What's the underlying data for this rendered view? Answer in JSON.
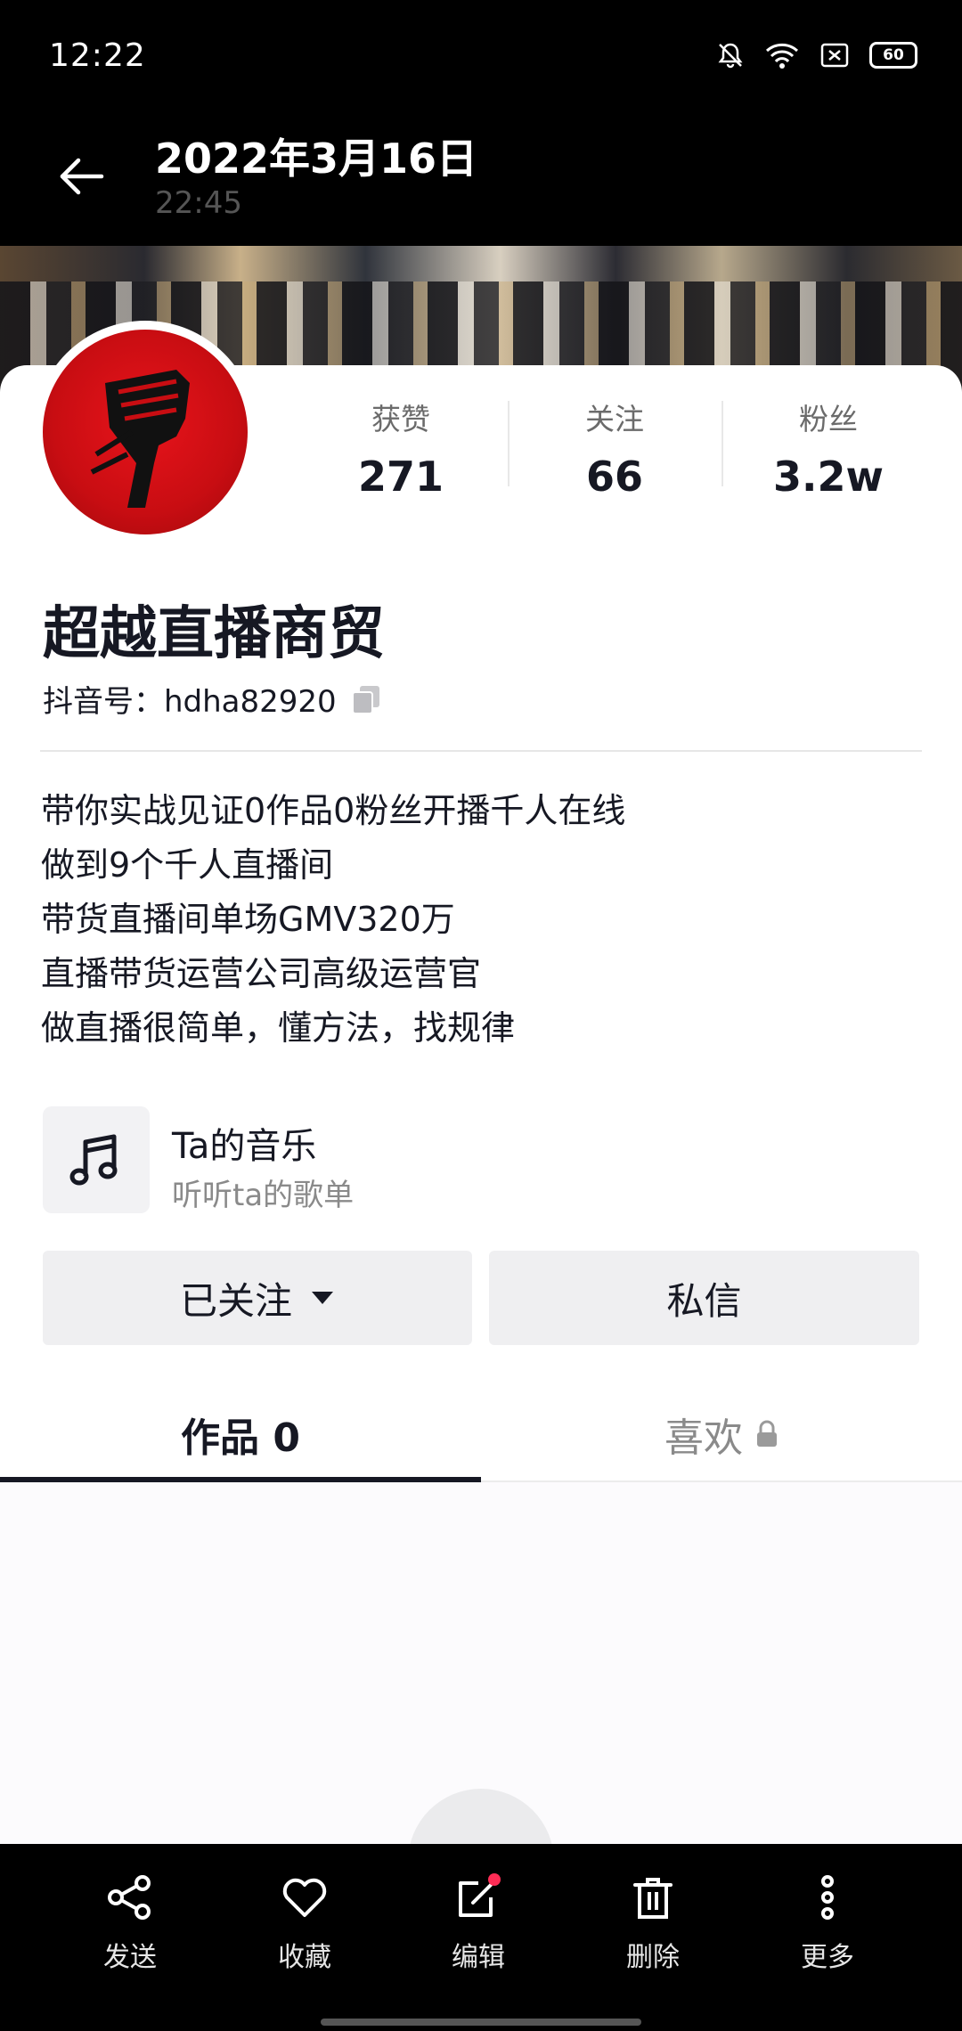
{
  "status": {
    "time": "12:22",
    "battery": "60"
  },
  "header": {
    "title": "2022年3月16日",
    "subtitle": "22:45"
  },
  "profile": {
    "stats": [
      {
        "label": "获赞",
        "value": "271"
      },
      {
        "label": "关注",
        "value": "66"
      },
      {
        "label": "粉丝",
        "value": "3.2w"
      }
    ],
    "name": "超越直播商贸",
    "douyin_id": "抖音号：hdha82920",
    "bio": [
      "带你实战见证0作品0粉丝开播千人在线",
      "做到9个千人直播间",
      "带货直播间单场GMV320万",
      "直播带货运营公司高级运营官",
      "做直播很简单，懂方法，找规律"
    ],
    "music": {
      "title": "Ta的音乐",
      "subtitle": "听听ta的歌单"
    },
    "buttons": {
      "follow": "已关注",
      "message": "私信"
    },
    "tabs": [
      {
        "label": "作品 0"
      },
      {
        "label": "喜欢"
      }
    ]
  },
  "bottom_bar": {
    "items": [
      {
        "label": "发送",
        "icon": "share-icon"
      },
      {
        "label": "收藏",
        "icon": "heart-icon"
      },
      {
        "label": "编辑",
        "icon": "edit-icon"
      },
      {
        "label": "删除",
        "icon": "trash-icon"
      },
      {
        "label": "更多",
        "icon": "more-icon"
      }
    ]
  },
  "colors": {
    "accent": "#fe2c55",
    "text": "#161823",
    "avatar_red": "#d90f15"
  }
}
